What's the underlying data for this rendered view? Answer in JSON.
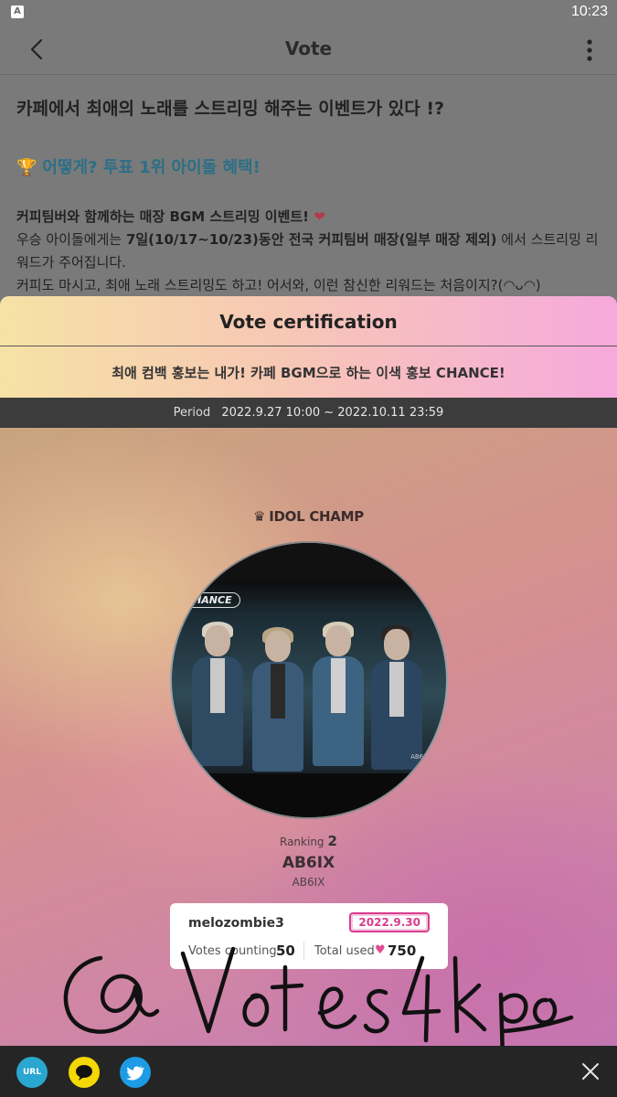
{
  "status_bar": {
    "time": "10:23",
    "app_icon_letter": "A"
  },
  "app_bar": {
    "title": "Vote",
    "back_icon": "chevron-left-icon",
    "more_icon": "more-vertical-icon"
  },
  "article": {
    "headline": "카페에서 최애의 노래를 스트리밍 해주는 이벤트가 있다 !?",
    "subheading": "어떻게? 투표 1위 아이돌 혜택!",
    "trophy_icon": "🏆",
    "paragraph1": "커피팀버와 함께하는 매장 BGM 스트리밍 이벤트!",
    "heart_glyph": "❤",
    "paragraph2_pre": "우승 아이돌에게는 ",
    "paragraph2_bold": "7일(10/17~10/23)동안 전국 커피팀버 매장(일부 매장 제외)",
    "paragraph2_post": " 에서 스트리밍 리워드가 주어집니다.",
    "paragraph3": "커피도 마시고, 최애 노래 스트리밍도 하고! 어서와, 이런 참신한 리워드는 처음이지?(◠ᴗ◠)"
  },
  "sheet": {
    "title": "Vote certification",
    "subtitle": "최애 컴백 홍보는 내가! 카페 BGM으로 하는 이색 홍보 CHANCE!",
    "period_label": "Period",
    "period_value": "2022.9.27 10:00 ~ 2022.10.11 23:59"
  },
  "certificate": {
    "logo_text": "IDOL CHAMP",
    "crown_glyph": "♛",
    "photo_tag": "CHANCE",
    "photo_mark": "AB6IX",
    "ranking_label": "Ranking",
    "ranking_value": "2",
    "idol_name": "AB6IX",
    "idol_sub": "AB6IX",
    "username": "melozombie3",
    "date": "2022.9.30",
    "votes_label": "Votes counting",
    "votes_value": "50",
    "total_label": "Total used",
    "total_heart": "♥",
    "total_value": "750",
    "watermark_text": "@ Votes4kpop_"
  },
  "share_bar": {
    "url_label": "URL",
    "icons": [
      "url-icon",
      "kakaotalk-icon",
      "twitter-icon",
      "close-icon"
    ]
  },
  "colors": {
    "accent_pink": "#d83d8d",
    "teal_heading": "#2c6f86",
    "share_bar_bg": "#252525"
  }
}
